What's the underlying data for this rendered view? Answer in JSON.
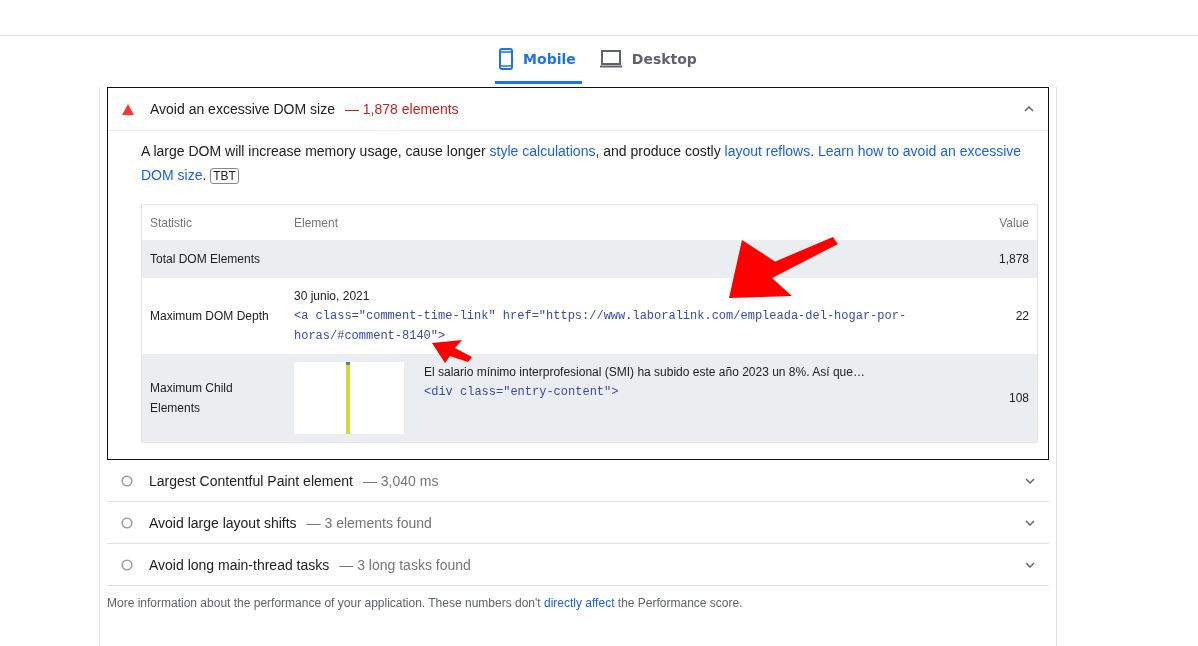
{
  "tabs": [
    {
      "label": "Mobile",
      "kind": "phone",
      "selected": true
    },
    {
      "label": "Desktop",
      "kind": "monitor",
      "selected": false
    }
  ],
  "audits": [
    {
      "kind": "fail",
      "title": "Avoid an excessive DOM size",
      "display_value": "— 1,878 elements",
      "expanded": true,
      "description": [
        {
          "text": "A large DOM will increase memory usage, cause longer ",
          "link": false
        },
        {
          "text": "style calculations",
          "link": true
        },
        {
          "text": ", and produce costly ",
          "link": false
        },
        {
          "text": "layout reflows",
          "link": true
        },
        {
          "text": ". ",
          "link": false
        },
        {
          "text": "Learn how to avoid an excessive",
          "link": true
        },
        {
          "text": "DOM size",
          "link": true
        },
        {
          "text": ".",
          "link": false
        }
      ],
      "tag": "TBT",
      "table": {
        "columns": [
          "Statistic",
          "Element",
          "Value"
        ],
        "rows": [
          {
            "statistic": "Total DOM Elements",
            "value": "1,878"
          },
          {
            "statistic": "Maximum DOM Depth",
            "element": {
              "thumbnail": false,
              "snippet": "30 junio, 2021",
              "code": "<a class=\"comment-time-link\" href=\"https://www.laboralink.com/empleada-del-hogar-por-horas/#comment-8140\">"
            },
            "value": "22"
          },
          {
            "statistic": "Maximum Child Elements",
            "element": {
              "thumbnail": true,
              "snippet": "El salario mínimo interprofesional (SMI) ha subido este año 2023 un 8%. Así que…",
              "code": "<div class=\"entry-content\">"
            },
            "value": "108"
          }
        ]
      }
    },
    {
      "kind": "info",
      "title": "Largest Contentful Paint element",
      "display_value": "— 3,040 ms",
      "expanded": false
    },
    {
      "kind": "info",
      "title": "Avoid large layout shifts",
      "display_value": "— 3 elements found",
      "expanded": false
    },
    {
      "kind": "info",
      "title": "Avoid long main-thread tasks",
      "display_value": "— 3 long tasks found",
      "expanded": false
    }
  ],
  "footer": [
    {
      "text": "More information about the performance of your application. These numbers don't ",
      "link": false
    },
    {
      "text": "directly affect",
      "link": true
    },
    {
      "text": " the Performance score.",
      "link": false
    }
  ]
}
